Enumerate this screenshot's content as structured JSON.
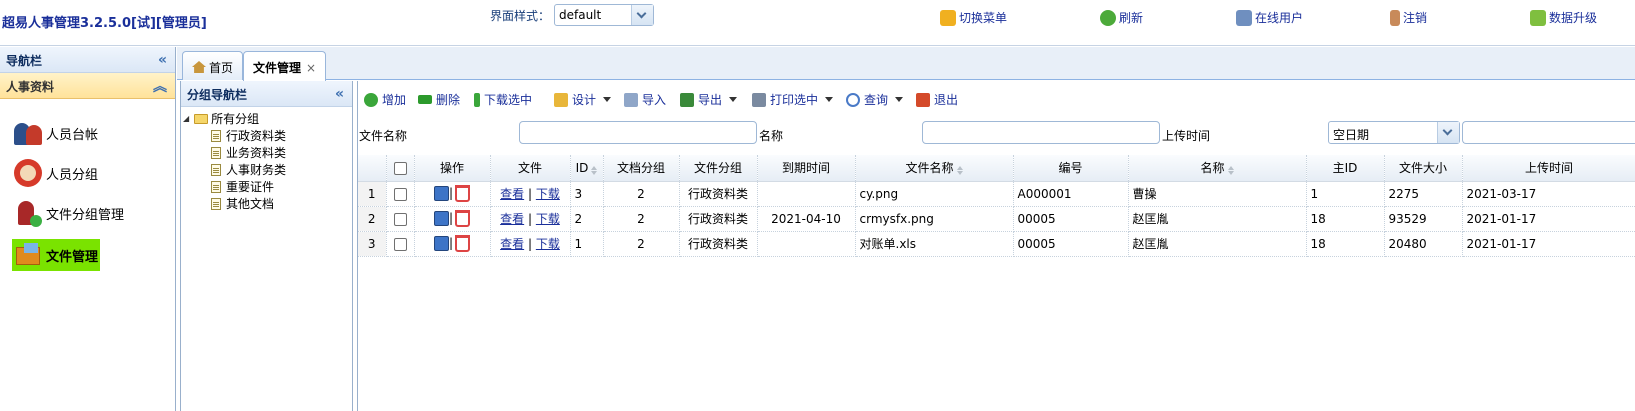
{
  "header": {
    "app_title": "超易人事管理3.2.5.0[试][管理员]",
    "theme_label": "界面样式：",
    "theme_value": "default",
    "actions": [
      {
        "label": "切换菜单",
        "icon": "switch-menu-icon"
      },
      {
        "label": "刷新",
        "icon": "refresh-icon"
      },
      {
        "label": "在线用户",
        "icon": "online-users-icon"
      },
      {
        "label": "注销",
        "icon": "logout-icon"
      },
      {
        "label": "数据升级",
        "icon": "data-upgrade-icon"
      }
    ]
  },
  "nav": {
    "title": "导航栏",
    "section": "人事资料",
    "items": [
      {
        "label": "人员台帐",
        "icon": "people-ledger-icon"
      },
      {
        "label": "人员分组",
        "icon": "people-group-icon"
      },
      {
        "label": "文件分组管理",
        "icon": "file-group-icon"
      },
      {
        "label": "文件管理",
        "icon": "file-manage-icon",
        "active": true
      }
    ]
  },
  "tabs": [
    {
      "label": "首页",
      "icon": "home-icon"
    },
    {
      "label": "文件管理",
      "selected": true,
      "close": "×"
    }
  ],
  "group_nav": {
    "title": "分组导航栏",
    "root": "所有分组",
    "children": [
      "行政资料类",
      "业务资料类",
      "人事财务类",
      "重要证件",
      "其他文档"
    ]
  },
  "toolbar": {
    "buttons": [
      {
        "label": "增加",
        "icon": "add-icon"
      },
      {
        "label": "删除",
        "icon": "delete-icon"
      },
      {
        "label": "下载选中",
        "icon": "download-icon"
      },
      {
        "label": "设计",
        "icon": "design-icon",
        "dropdown": true
      },
      {
        "label": "导入",
        "icon": "import-icon"
      },
      {
        "label": "导出",
        "icon": "export-icon",
        "dropdown": true
      },
      {
        "label": "打印选中",
        "icon": "print-icon",
        "dropdown": true
      },
      {
        "label": "查询",
        "icon": "search-icon",
        "dropdown": true
      },
      {
        "label": "退出",
        "icon": "exit-icon"
      }
    ]
  },
  "filters": {
    "file_name_label": "文件名称",
    "name_label": "名称",
    "upload_time_label": "上传时间",
    "date_select_value": "空日期"
  },
  "grid": {
    "columns": [
      "操作",
      "文件",
      "ID",
      "文档分组",
      "文件分组",
      "到期时间",
      "文件名称",
      "编号",
      "名称",
      "主ID",
      "文件大小",
      "上传时间"
    ],
    "view_label": "查看",
    "download_label": "下载",
    "separator": "|",
    "rows": [
      {
        "n": "1",
        "id": "3",
        "doc_group": "2",
        "file_group": "行政资料类",
        "expire": "",
        "file_name": "cy.png",
        "code": "A000001",
        "name": "曹操",
        "main_id": "1",
        "size": "2275",
        "upload": "2021-03-17"
      },
      {
        "n": "2",
        "id": "2",
        "doc_group": "2",
        "file_group": "行政资料类",
        "expire": "2021-04-10",
        "file_name": "crmysfx.png",
        "code": "00005",
        "name": "赵匡胤",
        "main_id": "18",
        "size": "93529",
        "upload": "2021-01-17"
      },
      {
        "n": "3",
        "id": "1",
        "doc_group": "2",
        "file_group": "行政资料类",
        "expire": "",
        "file_name": "对账单.xls",
        "code": "00005",
        "name": "赵匡胤",
        "main_id": "18",
        "size": "20480",
        "upload": "2021-01-17"
      }
    ]
  },
  "colors": {
    "link": "#1a2f9a",
    "active_nav": "#7ae300",
    "section_bg": "#ffe29a"
  }
}
